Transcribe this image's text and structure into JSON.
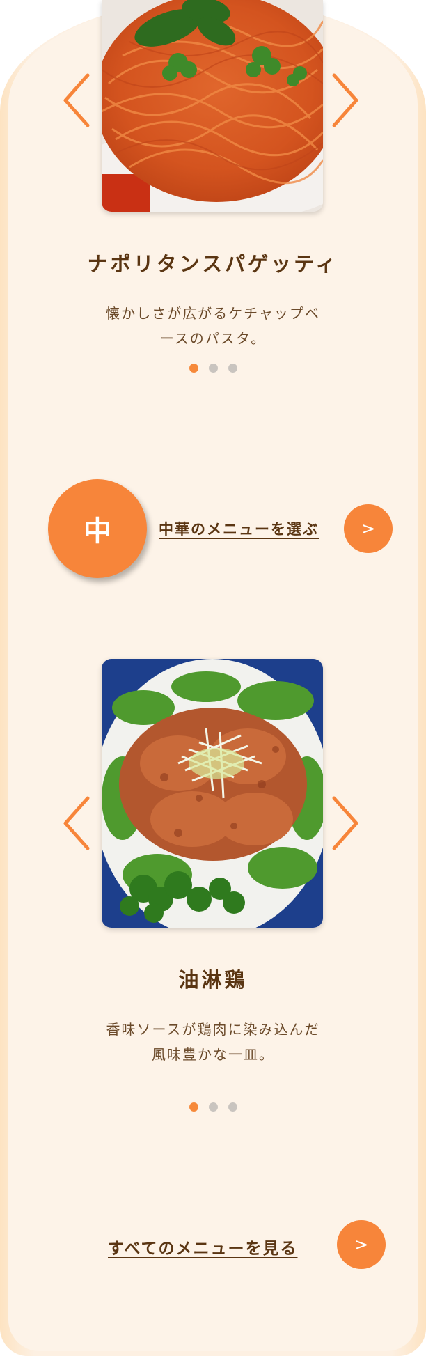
{
  "slides": [
    {
      "title": "ナポリタンスパゲッティ",
      "description": "懐かしさが広がるケチャップベースのパスタ。",
      "dots": 3,
      "active_dot": 0
    },
    {
      "title": "油淋鶏",
      "description": "香味ソースが鶏肉に染み込んだ風味豊かな一皿。",
      "dots": 3,
      "active_dot": 0
    }
  ],
  "category": {
    "circle_label": "中",
    "link_label": "中華のメニューを選ぶ",
    "button_label": ">"
  },
  "all_menu": {
    "link_label": "すべてのメニューを見る",
    "button_label": ">"
  },
  "colors": {
    "accent": "#f7853a",
    "text": "#5a3512",
    "panel": "#fdf3e8",
    "dot_inactive": "#c9c4bf"
  }
}
